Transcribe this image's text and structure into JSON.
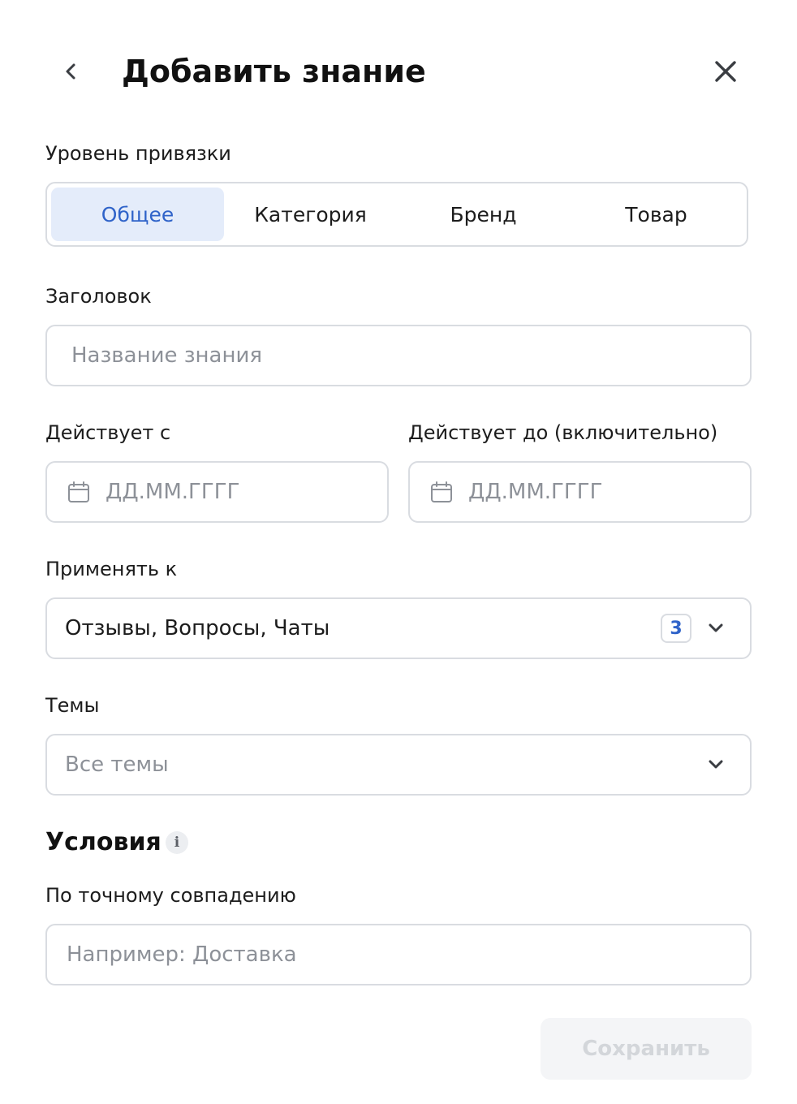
{
  "header": {
    "title": "Добавить знание"
  },
  "binding": {
    "label": "Уровень привязки",
    "options": [
      "Общее",
      "Категория",
      "Бренд",
      "Товар"
    ],
    "selected": "Общее"
  },
  "heading_field": {
    "label": "Заголовок",
    "placeholder": "Название знания",
    "value": ""
  },
  "valid_from": {
    "label": "Действует с",
    "placeholder": "ДД.ММ.ГГГГ"
  },
  "valid_to": {
    "label": "Действует до (включительно)",
    "placeholder": "ДД.ММ.ГГГГ"
  },
  "apply_to": {
    "label": "Применять к",
    "value": "Отзывы, Вопросы, Чаты",
    "count": "3"
  },
  "topics": {
    "label": "Темы",
    "value": "Все темы"
  },
  "conditions": {
    "title": "Условия",
    "info_icon": "i"
  },
  "exact_match": {
    "label": "По точному совпадению",
    "placeholder": "Например: Доставка",
    "value": ""
  },
  "footer": {
    "save_label": "Сохранить"
  },
  "colors": {
    "accent": "#2f63c9",
    "accent_bg": "#e4ecfa",
    "border": "#d9dce1",
    "placeholder": "#8d9198",
    "disabled_bg": "#f4f5f7",
    "disabled_text": "#d3d6da"
  },
  "icons": {
    "back": "chevron-left-icon",
    "close": "close-icon",
    "calendar": "calendar-icon",
    "dropdown": "chevron-down-icon",
    "info": "info-icon"
  }
}
